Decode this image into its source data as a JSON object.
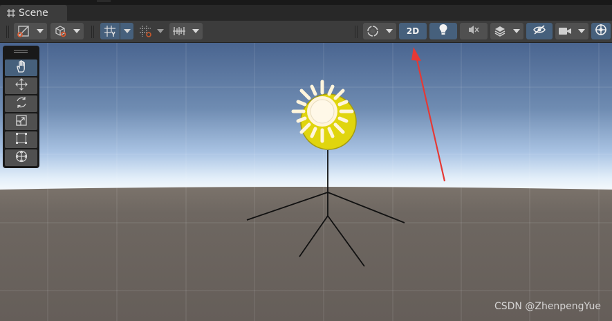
{
  "tab": {
    "title": "Scene",
    "icon": "grid-icon"
  },
  "toolbar": {
    "two_d_label": "2D",
    "buttons": [
      "draw-mode-button",
      "shading-mode-button",
      "grid-snap-button",
      "snap-increment-button",
      "grid-visibility-button",
      "render-mode-button",
      "2d-toggle-button",
      "lighting-toggle-button",
      "audio-toggle-button",
      "effects-button",
      "scene-visibility-button",
      "camera-button",
      "gizmos-button"
    ]
  },
  "tools": [
    "hand-tool",
    "move-tool",
    "rotate-tool",
    "scale-tool",
    "rect-tool",
    "transform-tool"
  ],
  "colors": {
    "accent": "#46607c",
    "annotation_arrow": "#e53935",
    "sun": "#e0d50e"
  },
  "watermark": "CSDN @ZhenpengYue"
}
